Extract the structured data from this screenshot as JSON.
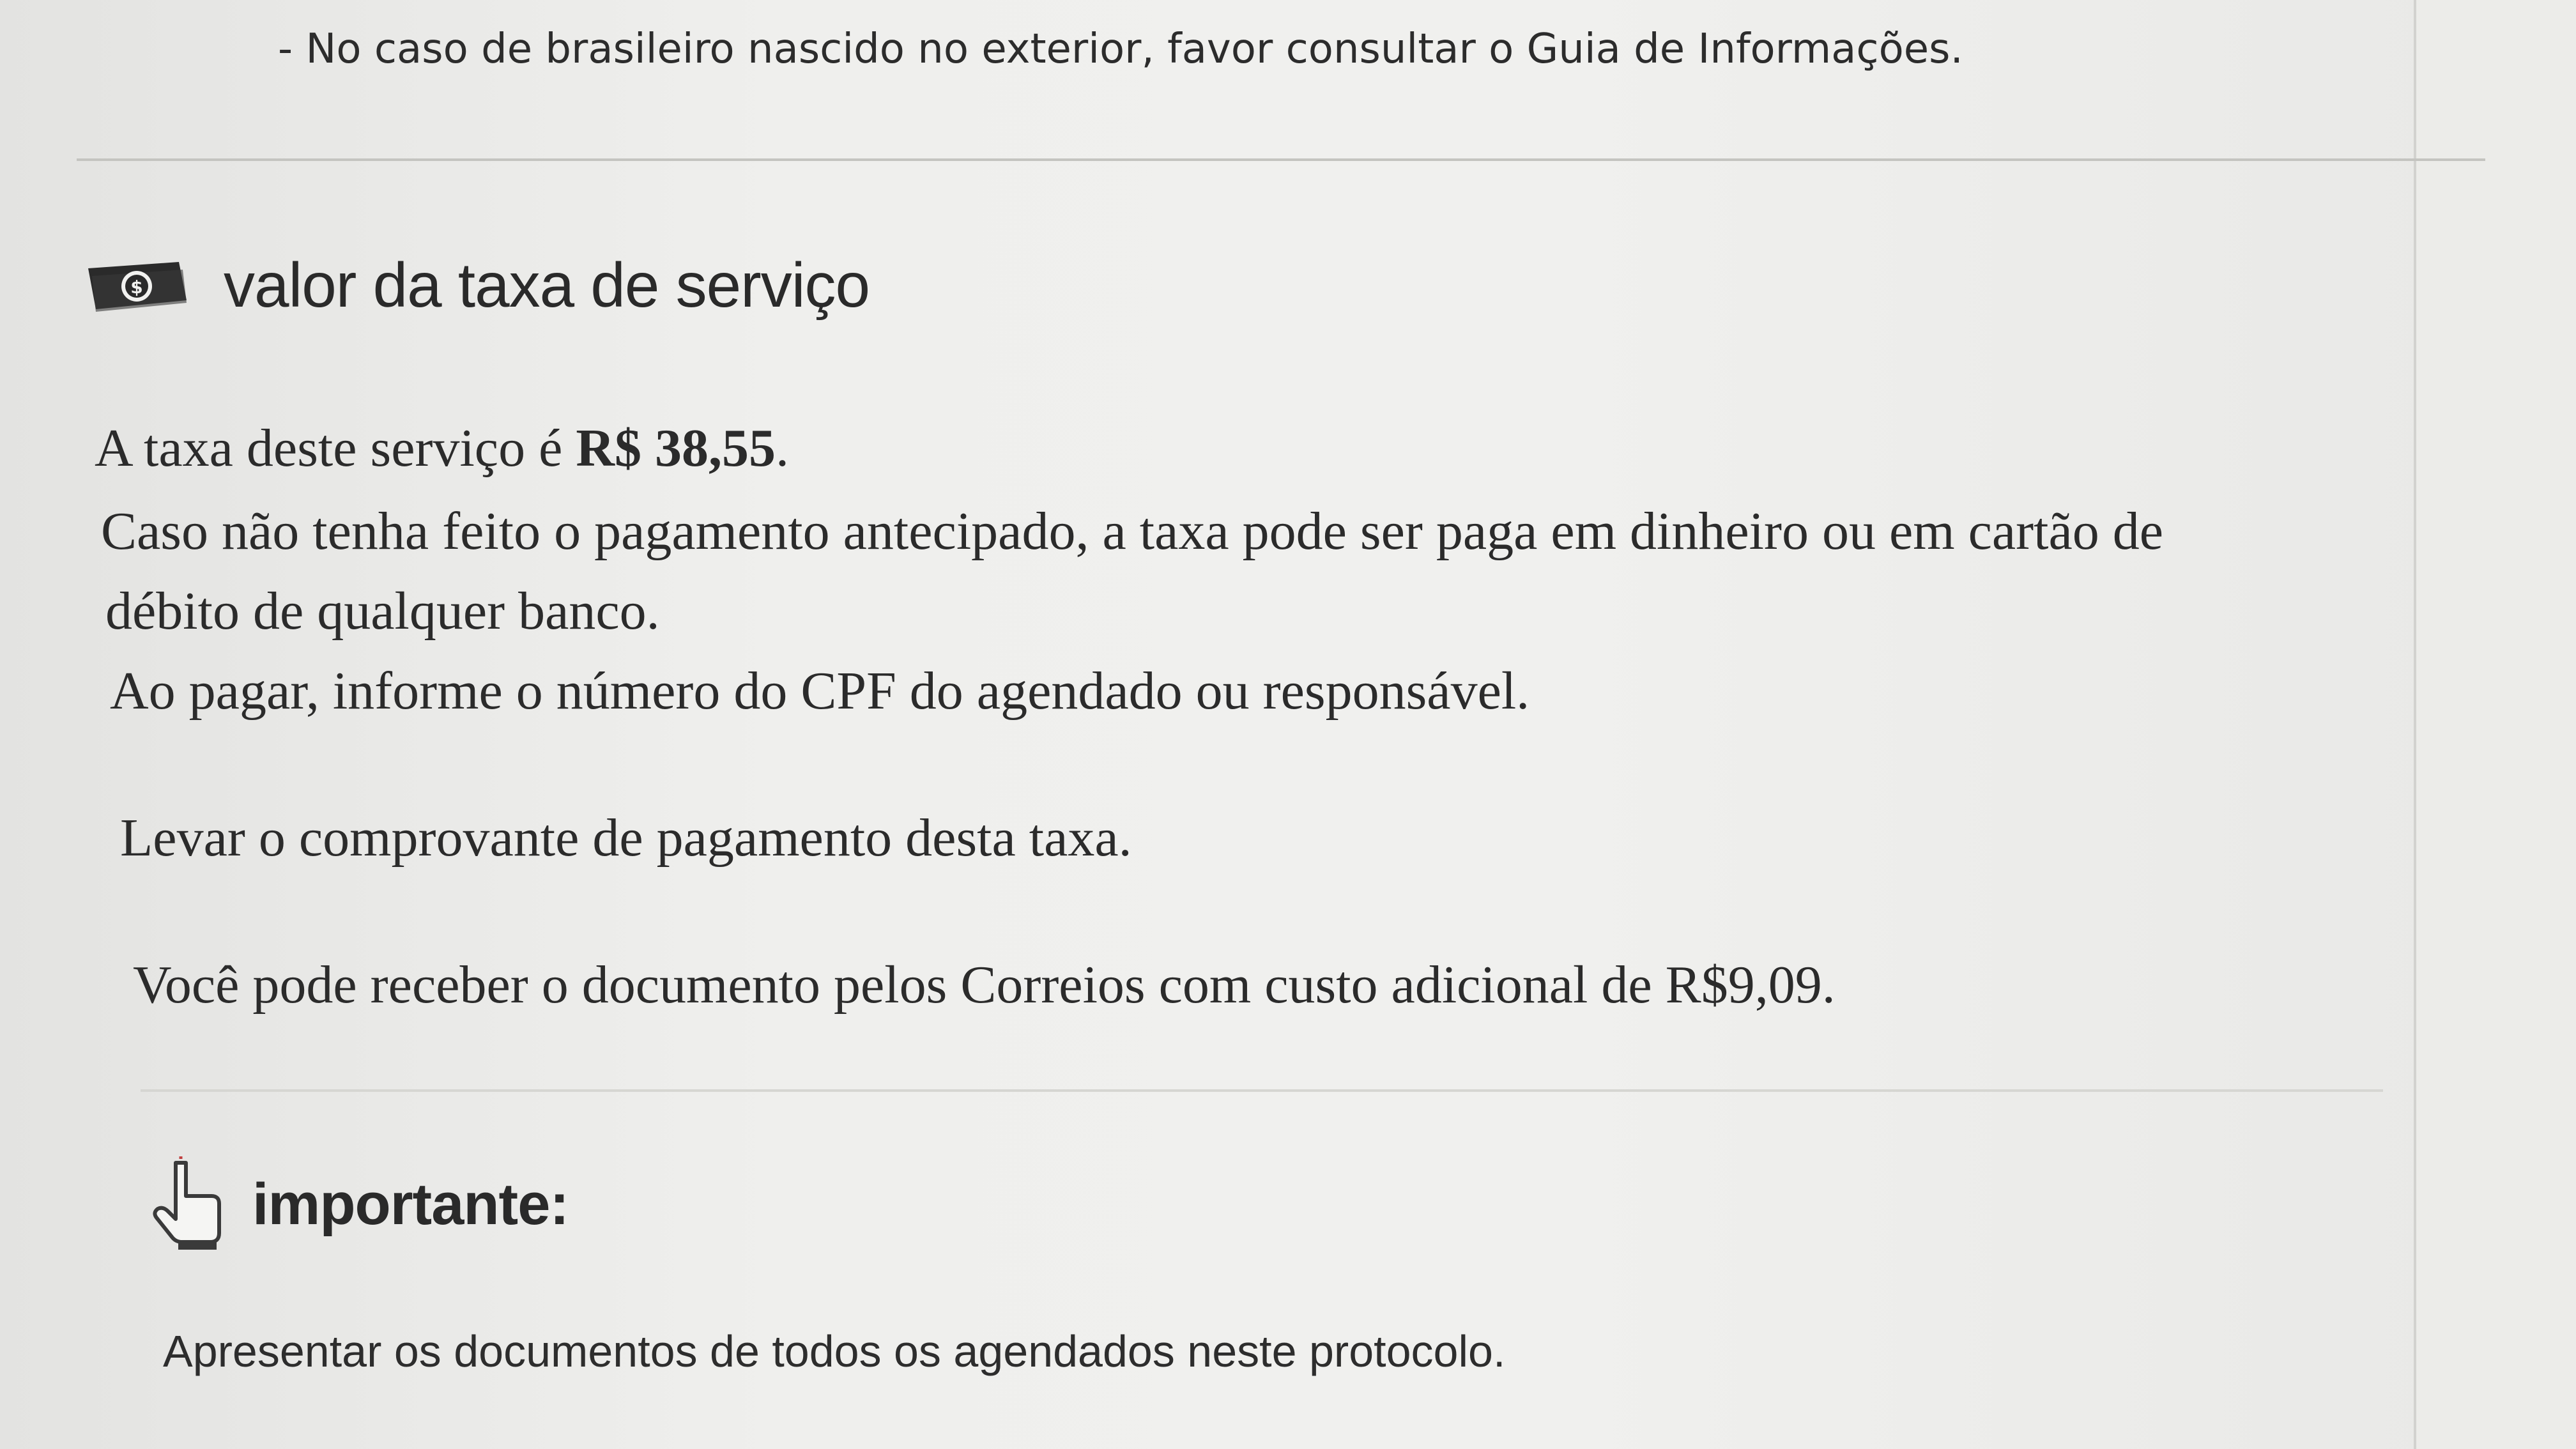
{
  "top_note": "- No caso de brasileiro nascido no exterior, favor consultar o Guia de Informações.",
  "fee_section": {
    "icon": "money-bill-icon",
    "title": "valor da taxa de serviço",
    "fee_prefix": "A taxa deste serviço é ",
    "fee_amount": "R$ 38,55",
    "fee_suffix": ".",
    "payment_line_1": "Caso não tenha feito o pagamento antecipado, a taxa pode ser paga em dinheiro ou em cartão de",
    "payment_line_2": "débito de qualquer banco.",
    "cpf_line": "Ao pagar, informe o número do CPF do agendado ou responsável.",
    "receipt_line": "Levar o comprovante de pagamento desta taxa.",
    "mail_line": "Você pode receber o documento pelos Correios com custo adicional de R$9,09."
  },
  "important_section": {
    "icon": "pointing-hand-icon",
    "title": "importante:",
    "text": "Apresentar os documentos de todos os agendados neste protocolo."
  }
}
